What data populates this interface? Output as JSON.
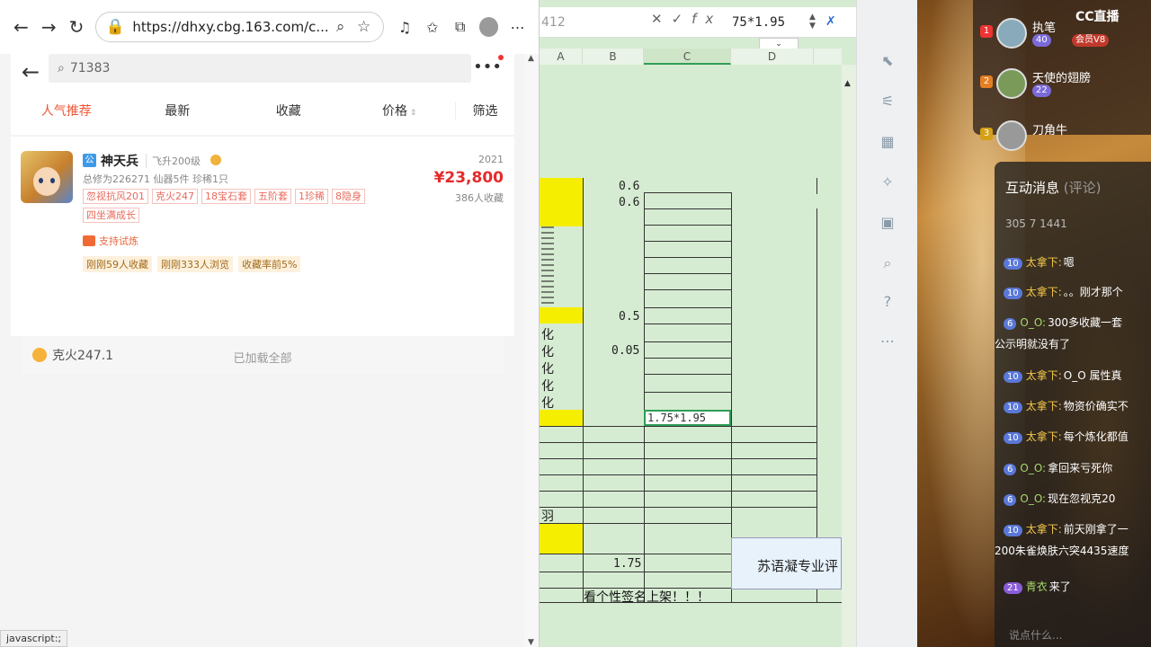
{
  "browser": {
    "url": "https://dhxy.cbg.163.com/c...",
    "status_text": "javascript:;"
  },
  "search": {
    "value": "71383"
  },
  "sort_tabs": [
    "人气推荐",
    "最新",
    "收藏",
    "价格",
    "筛选"
  ],
  "item": {
    "server_tag": "公",
    "name": "神天兵",
    "level": "飞升200级",
    "stats": "总修为226271  仙器5件  珍稀1只",
    "year": "2021",
    "price": "¥23,800",
    "favorites": "386人收藏",
    "tags": [
      "忽视抗风201",
      "克火247",
      "18宝石套",
      "五阶套",
      "1珍稀",
      "8隐身",
      "四坐满成长"
    ],
    "trial": "支持试炼",
    "pills": [
      "刚刚59人收藏",
      "刚刚333人浏览",
      "收藏率前5%"
    ],
    "keihuo": "克火247.1"
  },
  "loaded_all": "已加载全部",
  "sheet": {
    "namebox": "412",
    "formula": "75*1.95",
    "columns": [
      "A",
      "B",
      "C",
      "D"
    ],
    "values": [
      "0.6",
      "0.6",
      "0.5",
      "0.05",
      "1.75"
    ],
    "active_cell": "1.75*1.95",
    "left_chars": [
      "化",
      "化",
      "化",
      "化",
      "化",
      "羽"
    ],
    "merged_text": "苏语凝专业评",
    "sign_text": "看个性签名上架！！！"
  },
  "stream": {
    "logo": "CC直播",
    "rank": [
      {
        "num": "1",
        "name": "执笔",
        "lv1": "40",
        "lv2": "会员V8"
      },
      {
        "num": "2",
        "name": "天使的翅膀",
        "lv1": "22",
        "lv2": ""
      },
      {
        "num": "3",
        "name": "刀角牛",
        "lv1": "",
        "lv2": ""
      }
    ],
    "chat_title": "互动消息",
    "chat_sub": "(评论)",
    "chat_stats": "305   7   1441",
    "messages": [
      {
        "lv": "10",
        "user": "太拿下:",
        "text": "嗯"
      },
      {
        "lv": "10",
        "user": "太拿下:",
        "text": "。。刚才那个"
      },
      {
        "lv": "6",
        "user": "O_O:",
        "text": "300多收藏一套"
      },
      {
        "lv": "",
        "user": "",
        "text": "公示明就没有了"
      },
      {
        "lv": "10",
        "user": "太拿下:",
        "text": "O_O 属性真"
      },
      {
        "lv": "10",
        "user": "太拿下:",
        "text": "物资价确实不"
      },
      {
        "lv": "10",
        "user": "太拿下:",
        "text": "每个炼化都值"
      },
      {
        "lv": "6",
        "user": "O_O:",
        "text": "拿回来亏死你"
      },
      {
        "lv": "6",
        "user": "O_O:",
        "text": "现在忽视克20"
      },
      {
        "lv": "10",
        "user": "太拿下:",
        "text": "前天刚拿了一"
      },
      {
        "lv": "",
        "user": "",
        "text": "200朱雀焕肤六突4435速度"
      },
      {
        "lv": "21",
        "user": "青衣",
        "text": "来了"
      }
    ],
    "chat_placeholder": "说点什么..."
  }
}
